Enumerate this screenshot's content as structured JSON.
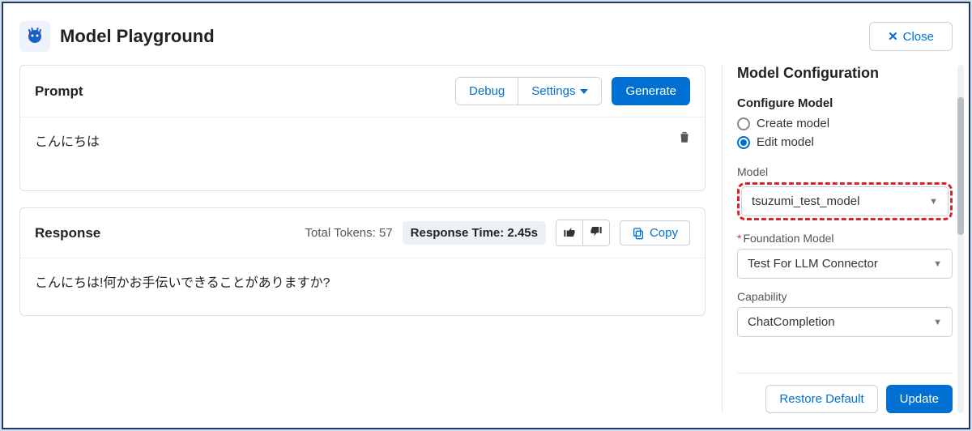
{
  "header": {
    "title": "Model Playground",
    "close_label": "Close"
  },
  "prompt": {
    "title": "Prompt",
    "debug_label": "Debug",
    "settings_label": "Settings",
    "generate_label": "Generate",
    "text": "こんにちは"
  },
  "response": {
    "title": "Response",
    "total_tokens_label": "Total Tokens: 57",
    "response_time_label": "Response Time: 2.45s",
    "copy_label": "Copy",
    "text": "こんにちは!何かお手伝いできることがありますか?"
  },
  "config": {
    "panel_title": "Model Configuration",
    "configure_title": "Configure Model",
    "create_label": "Create model",
    "edit_label": "Edit model",
    "model_label": "Model",
    "model_value": "tsuzumi_test_model",
    "foundation_label": "Foundation Model",
    "foundation_value": "Test For LLM Connector",
    "capability_label": "Capability",
    "capability_value": "ChatCompletion",
    "restore_label": "Restore Default",
    "update_label": "Update"
  }
}
